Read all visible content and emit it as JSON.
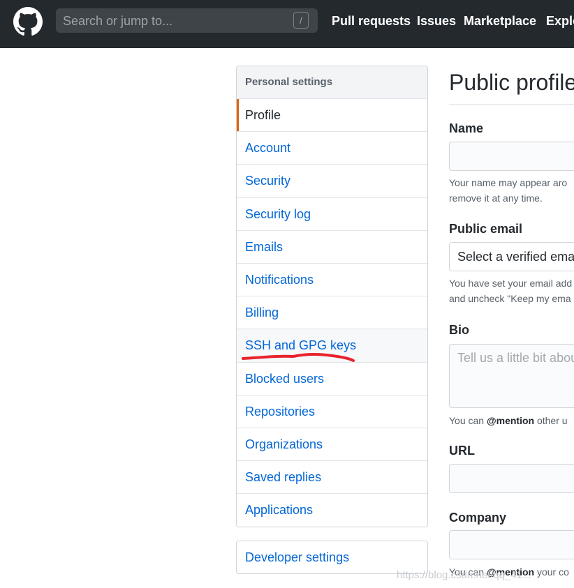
{
  "header": {
    "logo_icon": "github-octocat-icon",
    "search_placeholder": "Search or jump to...",
    "slash_key": "/",
    "nav": [
      {
        "label": "Pull requests"
      },
      {
        "label": "Issues"
      },
      {
        "label": "Marketplace"
      },
      {
        "label": "Explo"
      }
    ],
    "colors": {
      "background": "#24292e",
      "text": "#ffffff"
    }
  },
  "sidebar": {
    "heading": "Personal settings",
    "items": [
      {
        "label": "Profile",
        "selected": true
      },
      {
        "label": "Account"
      },
      {
        "label": "Security"
      },
      {
        "label": "Security log"
      },
      {
        "label": "Emails"
      },
      {
        "label": "Notifications"
      },
      {
        "label": "Billing"
      },
      {
        "label": "SSH and GPG keys",
        "highlighted": true
      },
      {
        "label": "Blocked users"
      },
      {
        "label": "Repositories"
      },
      {
        "label": "Organizations"
      },
      {
        "label": "Saved replies"
      },
      {
        "label": "Applications"
      }
    ],
    "developer_settings": "Developer settings",
    "colors": {
      "link": "#0366d6",
      "selected_accent": "#e36209",
      "annotation": "#e8232b"
    }
  },
  "main": {
    "title": "Public profile",
    "name": {
      "label": "Name",
      "value": "",
      "note_line1": "Your name may appear aro",
      "note_line2": "remove it at any time."
    },
    "public_email": {
      "label": "Public email",
      "selected": "Select a verified email",
      "note_line1": "You have set your email add",
      "note_line2": "and uncheck \"Keep my ema"
    },
    "bio": {
      "label": "Bio",
      "placeholder": "Tell us a little bit abou",
      "note_prefix": "You can ",
      "note_mention": "@mention",
      "note_suffix": " other u"
    },
    "url": {
      "label": "URL",
      "value": ""
    },
    "company": {
      "label": "Company",
      "value": "",
      "note_prefix": "You can ",
      "note_mention": "@mention",
      "note_suffix": " your co"
    }
  },
  "watermark": "https://blog.csdn.net/qq_41..."
}
